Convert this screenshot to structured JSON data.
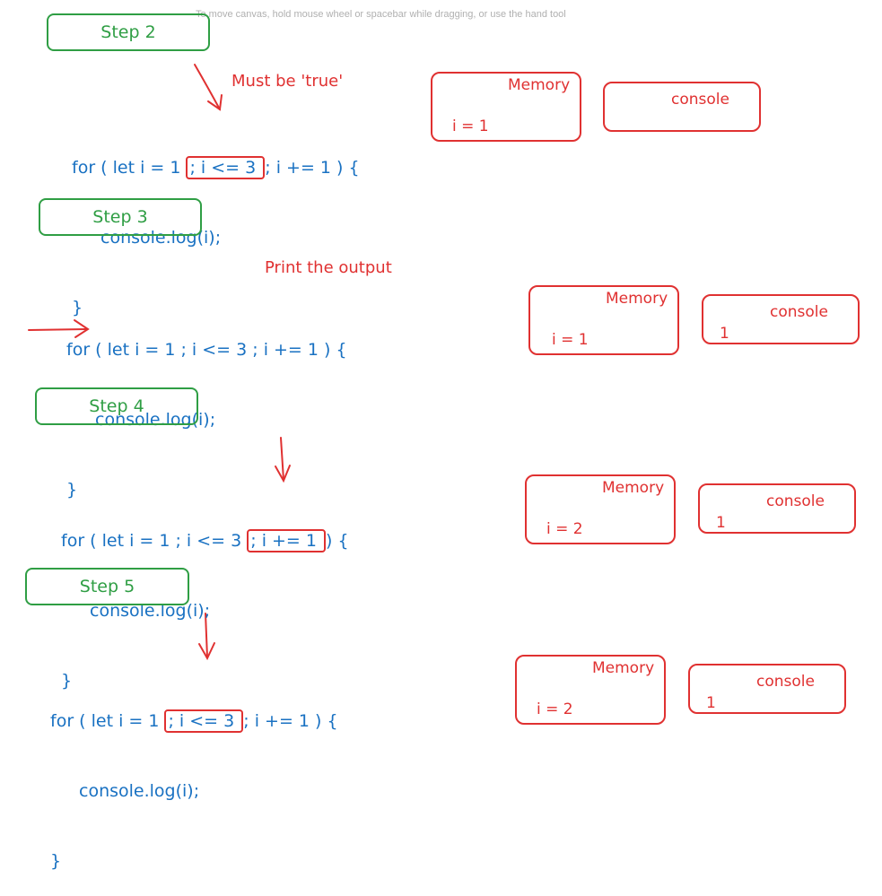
{
  "canvas_hint": "To move canvas, hold mouse wheel or spacebar while dragging, or use the hand tool",
  "colors": {
    "green": "#2f9e44",
    "blue": "#1971c2",
    "red": "#e03131"
  },
  "steps": [
    {
      "label": "Step 2",
      "note": "Must be 'true'",
      "code": {
        "line1_pre": "for ( let i = 1 ",
        "line1_hl": "; i <= 3 ",
        "line1_post": "; i += 1 ) {",
        "line2": "console.log(i);",
        "line3": "}"
      },
      "memory": {
        "title": "Memory",
        "value": "i = 1"
      },
      "console": {
        "title": "console",
        "value": ""
      }
    },
    {
      "label": "Step 3",
      "note": "Print the output",
      "code": {
        "line1_pre": "for ( let i = 1 ; i <= 3 ; i += 1 ) {",
        "line1_hl": "",
        "line1_post": "",
        "line2": "console.log(i);",
        "line3": "}"
      },
      "memory": {
        "title": "Memory",
        "value": "i = 1"
      },
      "console": {
        "title": "console",
        "value": "1"
      }
    },
    {
      "label": "Step 4",
      "note": "",
      "code": {
        "line1_pre": "for ( let i = 1 ; i <= 3 ",
        "line1_hl": "; i += 1 ",
        "line1_post": ") {",
        "line2": "console.log(i);",
        "line3": "}"
      },
      "memory": {
        "title": "Memory",
        "value": "i = 2"
      },
      "console": {
        "title": "console",
        "value": "1"
      }
    },
    {
      "label": "Step 5",
      "note": "",
      "code": {
        "line1_pre": "for ( let i = 1 ",
        "line1_hl": "; i <= 3 ",
        "line1_post": "; i += 1 ) {",
        "line2": "console.log(i);",
        "line3": "}"
      },
      "memory": {
        "title": "Memory",
        "value": "i = 2"
      },
      "console": {
        "title": "console",
        "value": "1"
      }
    }
  ]
}
